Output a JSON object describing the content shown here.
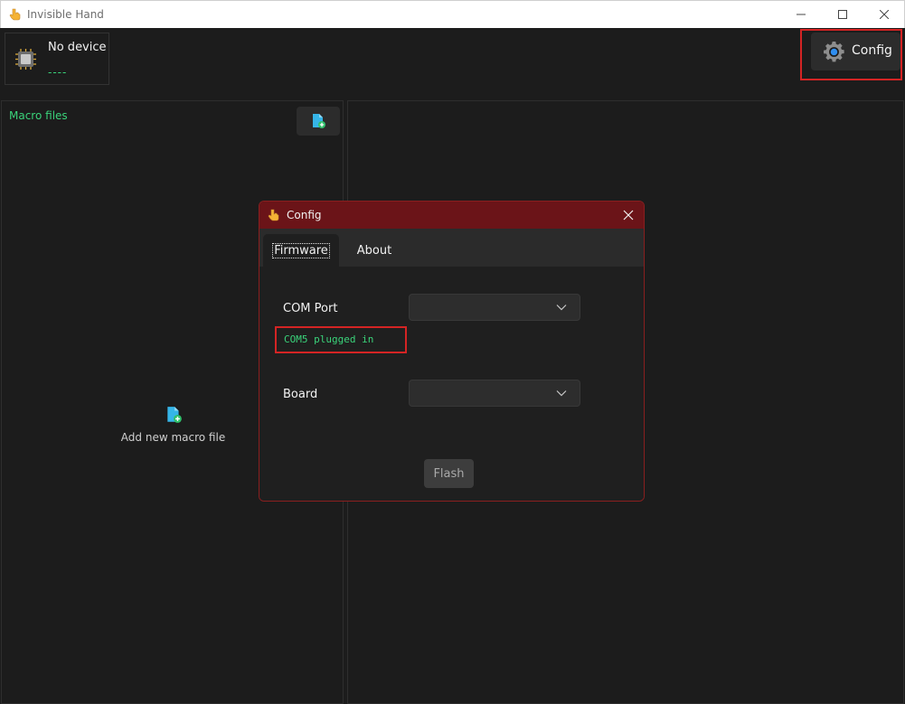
{
  "window": {
    "title": "Invisible Hand",
    "app_icon": "pointing-hand-icon"
  },
  "device": {
    "name": "No device",
    "status": "----",
    "icon": "chip-icon"
  },
  "toolbar": {
    "config_label": "Config",
    "config_icon": "gear-icon"
  },
  "macro_panel": {
    "heading": "Macro files",
    "add_icon": "add-file-icon",
    "empty_label": "Add new macro file"
  },
  "config_dialog": {
    "title": "Config",
    "tabs": [
      {
        "label": "Firmware",
        "active": true
      },
      {
        "label": "About",
        "active": false
      }
    ],
    "com_port": {
      "label": "COM Port",
      "value": "",
      "status": "COM5 plugged in"
    },
    "board": {
      "label": "Board",
      "value": ""
    },
    "flash_label": "Flash"
  },
  "colors": {
    "accent_green": "#3ad37a",
    "dialog_titlebar": "#6b1418",
    "highlight_red": "#d42424",
    "background": "#1c1c1c"
  }
}
